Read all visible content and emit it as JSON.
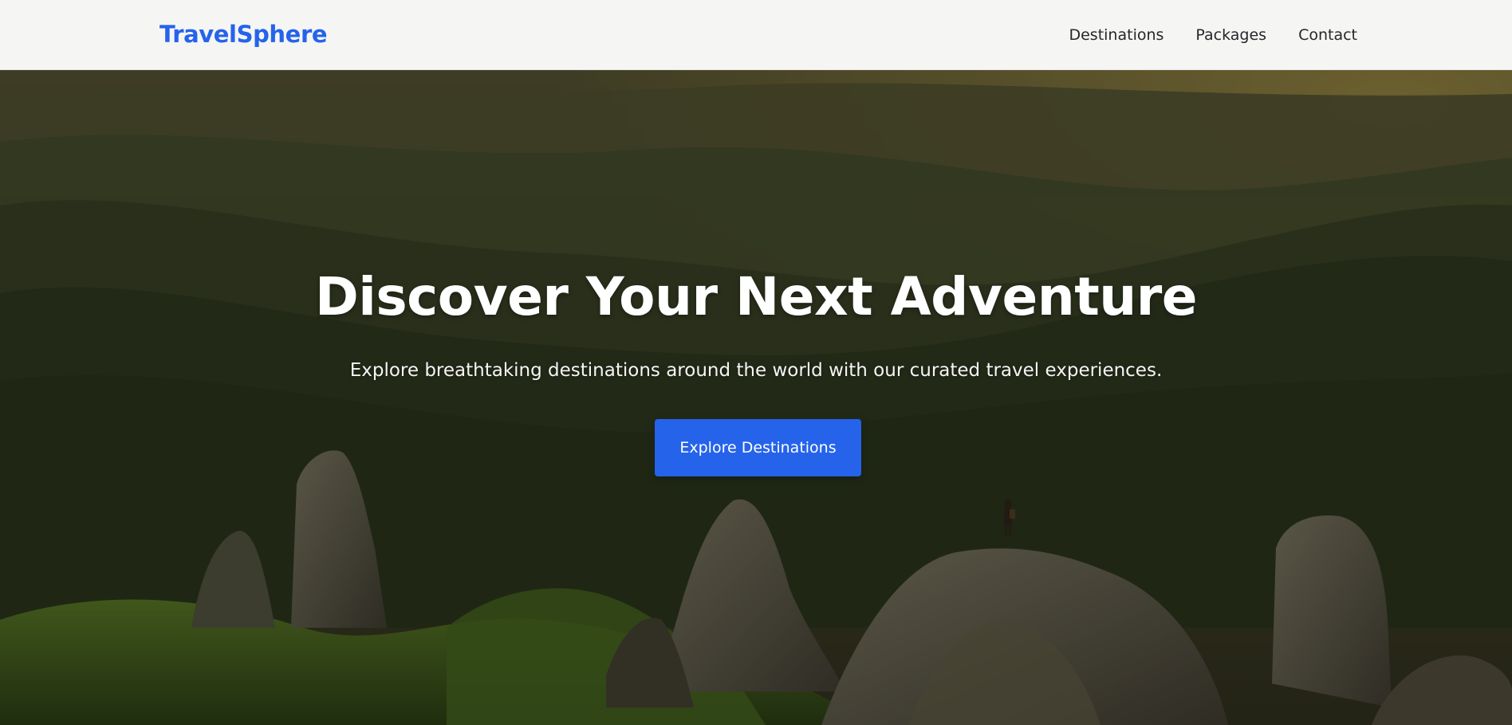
{
  "header": {
    "logo": "TravelSphere",
    "nav": [
      {
        "label": "Destinations"
      },
      {
        "label": "Packages"
      },
      {
        "label": "Contact"
      }
    ]
  },
  "hero": {
    "title": "Discover Your Next Adventure",
    "subtitle": "Explore breathtaking destinations around the world with our curated travel experiences.",
    "cta_label": "Explore Destinations",
    "background_image": "mountain-landscape-photo"
  },
  "colors": {
    "brand": "#2563eb",
    "nav_background": "#f5f5f4",
    "nav_text": "#27272a",
    "hero_text": "#ffffff"
  }
}
